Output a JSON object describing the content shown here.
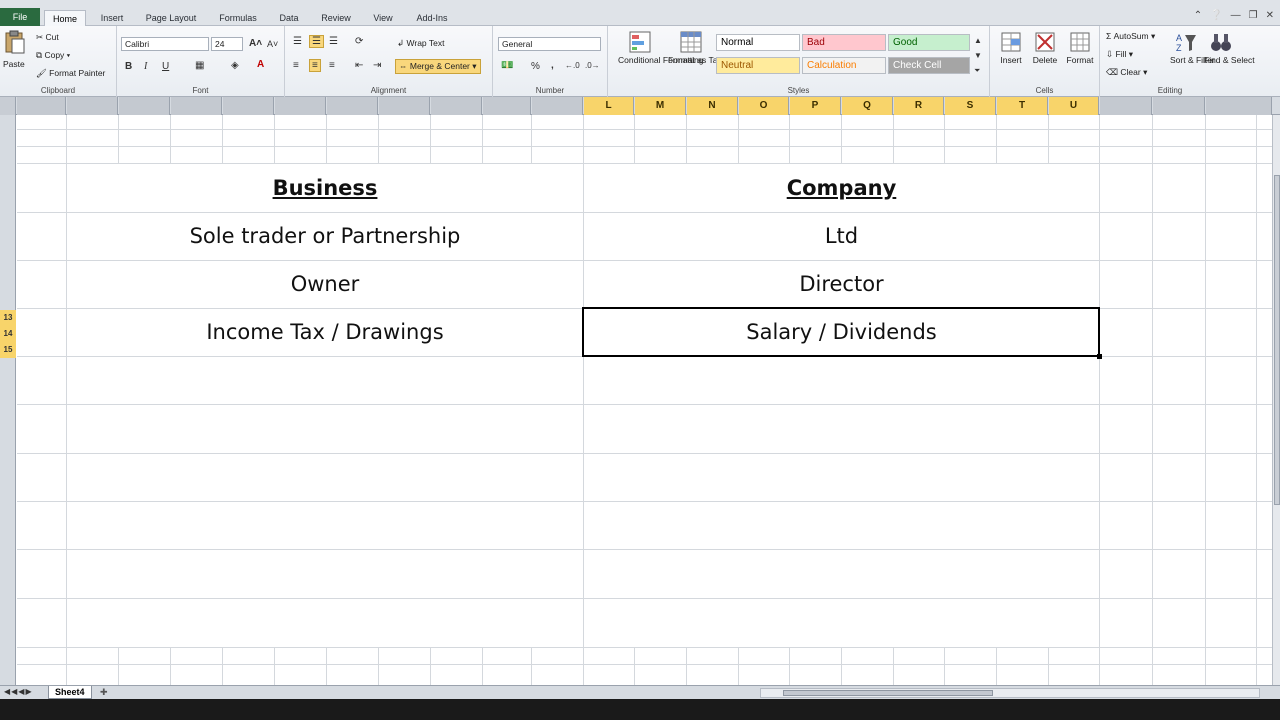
{
  "tabs": {
    "file": "File",
    "items": [
      "Home",
      "Insert",
      "Page Layout",
      "Formulas",
      "Data",
      "Review",
      "View",
      "Add-Ins"
    ],
    "active": "Home"
  },
  "ribbon": {
    "clipboard": {
      "label": "Clipboard",
      "paste": "Paste",
      "cut": "Cut",
      "copy": "Copy",
      "format_painter": "Format Painter"
    },
    "font": {
      "label": "Font",
      "name": "Calibri",
      "size": "24",
      "bold": "B",
      "italic": "I",
      "underline": "U"
    },
    "alignment": {
      "label": "Alignment",
      "wrap_text": "Wrap Text",
      "merge_center": "Merge & Center"
    },
    "number": {
      "label": "Number",
      "format": "General",
      "percent": "%",
      "comma": ","
    },
    "styles": {
      "label": "Styles",
      "conditional": "Conditional Formatting",
      "format_table": "Format as Table",
      "cells": [
        {
          "name": "Normal",
          "bg": "#ffffff",
          "fg": "#000000"
        },
        {
          "name": "Bad",
          "bg": "#ffc7ce",
          "fg": "#9c0006"
        },
        {
          "name": "Good",
          "bg": "#c6efce",
          "fg": "#006100"
        },
        {
          "name": "Neutral",
          "bg": "#ffeb9c",
          "fg": "#9c5700"
        },
        {
          "name": "Calculation",
          "bg": "#f2f2f2",
          "fg": "#fa7d00"
        },
        {
          "name": "Check Cell",
          "bg": "#a5a5a5",
          "fg": "#ffffff"
        }
      ]
    },
    "cells": {
      "label": "Cells",
      "insert": "Insert",
      "delete": "Delete",
      "format": "Format"
    },
    "editing": {
      "label": "Editing",
      "autosum": "AutoSum",
      "fill": "Fill",
      "clear": "Clear",
      "sort_filter": "Sort & Filter",
      "find_select": "Find & Select"
    }
  },
  "columns": {
    "selected": [
      "L",
      "M",
      "N",
      "O",
      "P",
      "Q",
      "R",
      "S",
      "T",
      "U"
    ]
  },
  "rows": {
    "selected": [
      "13",
      "14",
      "15"
    ]
  },
  "table": {
    "headers": [
      "Business",
      "Company"
    ],
    "rows": [
      [
        "Sole trader or Partnership",
        "Ltd"
      ],
      [
        "Owner",
        "Director"
      ],
      [
        "Income Tax / Drawings",
        "Salary / Dividends"
      ]
    ]
  },
  "sheet": {
    "name": "Sheet4"
  },
  "colors": {
    "selected_header": "#f8d46a",
    "excel_green": "#2a6a3f"
  }
}
